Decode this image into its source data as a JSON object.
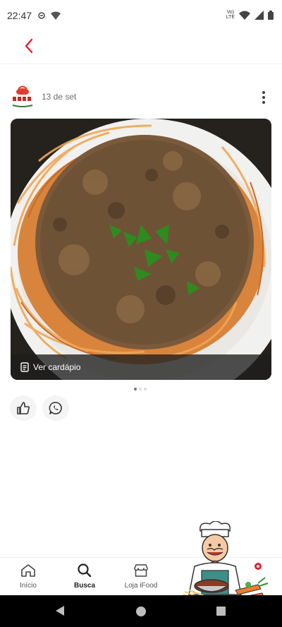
{
  "status_bar": {
    "time": "22:47",
    "network_label_top": "Vo)",
    "network_label_bottom": "LTE"
  },
  "header": {
    "back_icon": "chevron-left-icon",
    "accent_color": "#ea1d2c"
  },
  "post": {
    "date": "13 de set",
    "menu_label": "Ver cardápio",
    "carousel_pages": 3,
    "carousel_active_index": 0
  },
  "actions": {
    "like_icon": "thumbs-up-icon",
    "share_icon": "whatsapp-icon"
  },
  "bottom_nav": {
    "items": [
      {
        "label": "Início",
        "icon": "home-icon",
        "active": false
      },
      {
        "label": "Busca",
        "icon": "search-icon",
        "active": true
      },
      {
        "label": "Loja iFood",
        "icon": "store-icon",
        "active": false
      }
    ]
  }
}
